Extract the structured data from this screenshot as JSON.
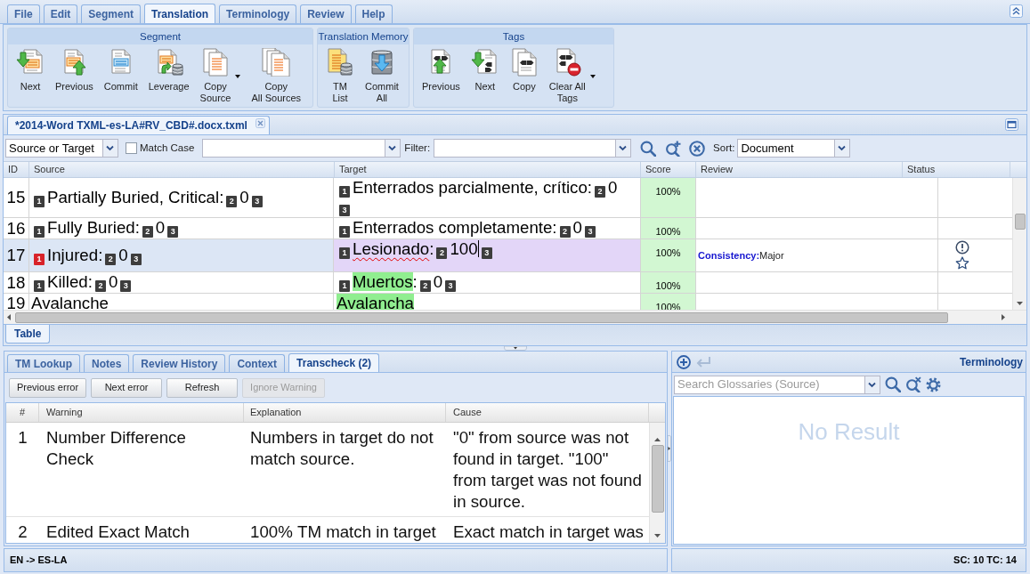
{
  "menu_tabs": [
    {
      "label": "File",
      "selected": false
    },
    {
      "label": "Edit",
      "selected": false
    },
    {
      "label": "Segment",
      "selected": false
    },
    {
      "label": "Translation",
      "selected": true
    },
    {
      "label": "Terminology",
      "selected": false
    },
    {
      "label": "Review",
      "selected": false
    },
    {
      "label": "Help",
      "selected": false
    }
  ],
  "ribbon_groups": [
    {
      "title": "Segment",
      "buttons": [
        {
          "label": "Next",
          "has_menu": false
        },
        {
          "label": "Previous",
          "has_menu": false
        },
        {
          "label": "Commit",
          "has_menu": false
        },
        {
          "label": "Leverage",
          "has_menu": false
        },
        {
          "label": "Copy\nSource",
          "has_menu": true
        },
        {
          "label": "Copy\nAll Sources",
          "has_menu": false
        }
      ]
    },
    {
      "title": "Translation Memory",
      "buttons": [
        {
          "label": "TM\nList",
          "has_menu": false
        },
        {
          "label": "Commit\nAll",
          "has_menu": false
        }
      ]
    },
    {
      "title": "Tags",
      "buttons": [
        {
          "label": "Previous",
          "has_menu": false
        },
        {
          "label": "Next",
          "has_menu": false
        },
        {
          "label": "Copy",
          "has_menu": false
        },
        {
          "label": "Clear All\nTags",
          "has_menu": true
        }
      ]
    }
  ],
  "document_tabs": [
    {
      "title": "*2014-Word TXML-es-LA#RV_CBD#.docx.txml",
      "selected": true
    }
  ],
  "filter_bar": {
    "scope": {
      "value": "Source or Target"
    },
    "match_case": {
      "label": "Match Case",
      "checked": false
    },
    "filter_label": "Filter:",
    "sort_label": "Sort:",
    "sort": {
      "value": "Document"
    }
  },
  "segment_table": {
    "columns": [
      "ID",
      "Source",
      "Target",
      "Score",
      "Review",
      "Status"
    ],
    "rows": [
      {
        "id": "15",
        "selected": false,
        "source": [
          {
            "kind": "tag",
            "label": "1",
            "active": false
          },
          {
            "kind": "text",
            "text": "Partially Buried, Critical:"
          },
          {
            "kind": "tag",
            "label": "2",
            "active": false
          },
          {
            "kind": "text",
            "text": "0"
          },
          {
            "kind": "tag",
            "label": "3",
            "active": false
          }
        ],
        "target": [
          {
            "kind": "tag",
            "label": "1",
            "active": false
          },
          {
            "kind": "text",
            "text": "Enterrados parcialmente, crítico:"
          },
          {
            "kind": "tag",
            "label": "2",
            "active": false
          },
          {
            "kind": "text",
            "text": "0"
          },
          {
            "kind": "tag",
            "label": "3",
            "active": false
          }
        ],
        "score": "100%",
        "warning": false,
        "starred": false
      },
      {
        "id": "16",
        "selected": false,
        "source": [
          {
            "kind": "tag",
            "label": "1",
            "active": false
          },
          {
            "kind": "text",
            "text": "Fully Buried:"
          },
          {
            "kind": "tag",
            "label": "2",
            "active": false
          },
          {
            "kind": "text",
            "text": "0"
          },
          {
            "kind": "tag",
            "label": "3",
            "active": false
          }
        ],
        "target": [
          {
            "kind": "tag",
            "label": "1",
            "active": false
          },
          {
            "kind": "text",
            "text": "Enterrados completamente:"
          },
          {
            "kind": "tag",
            "label": "2",
            "active": false
          },
          {
            "kind": "text",
            "text": "0"
          },
          {
            "kind": "tag",
            "label": "3",
            "active": false
          }
        ],
        "score": "100%",
        "warning": false,
        "starred": false
      },
      {
        "id": "17",
        "selected": true,
        "source": [
          {
            "kind": "tag",
            "label": "1",
            "active": true
          },
          {
            "kind": "text",
            "text": "Injured:"
          },
          {
            "kind": "tag",
            "label": "2",
            "active": false
          },
          {
            "kind": "text",
            "text": "0"
          },
          {
            "kind": "tag",
            "label": "3",
            "active": false
          }
        ],
        "target": [
          {
            "kind": "tag",
            "label": "1",
            "active": false
          },
          {
            "kind": "misspelled",
            "text": "Lesionado"
          },
          {
            "kind": "text",
            "text": ":"
          },
          {
            "kind": "tag",
            "label": "2",
            "active": false
          },
          {
            "kind": "text",
            "text": "100"
          },
          {
            "kind": "cursor"
          },
          {
            "kind": "tag",
            "label": "3",
            "active": false
          }
        ],
        "score": "100%",
        "review": {
          "category": "Consistency:",
          "severity": "Major"
        },
        "warning": true,
        "starred": true
      },
      {
        "id": "18",
        "selected": false,
        "source": [
          {
            "kind": "tag",
            "label": "1",
            "active": false
          },
          {
            "kind": "text",
            "text": "Killed:"
          },
          {
            "kind": "tag",
            "label": "2",
            "active": false
          },
          {
            "kind": "text",
            "text": "0"
          },
          {
            "kind": "tag",
            "label": "3",
            "active": false
          }
        ],
        "target": [
          {
            "kind": "tag",
            "label": "1",
            "active": false
          },
          {
            "kind": "match",
            "text": "Muertos"
          },
          {
            "kind": "text",
            "text": ":"
          },
          {
            "kind": "tag",
            "label": "2",
            "active": false
          },
          {
            "kind": "text",
            "text": "0"
          },
          {
            "kind": "tag",
            "label": "3",
            "active": false
          }
        ],
        "score": "100%",
        "warning": false,
        "starred": false
      },
      {
        "id": "19",
        "selected": false,
        "source": [
          {
            "kind": "text",
            "text": "Avalanche"
          }
        ],
        "target": [
          {
            "kind": "match",
            "text": "Avalancha"
          }
        ],
        "score": "100%",
        "warning": false,
        "starred": false
      }
    ]
  },
  "view_tabs": [
    {
      "label": "Table",
      "selected": true
    }
  ],
  "bottom_tabs": [
    {
      "label": "TM Lookup",
      "selected": false
    },
    {
      "label": "Notes",
      "selected": false
    },
    {
      "label": "Review History",
      "selected": false
    },
    {
      "label": "Context",
      "selected": false
    },
    {
      "label": "Transcheck (2)",
      "selected": true
    }
  ],
  "transcheck": {
    "buttons": [
      {
        "label": "Previous error",
        "disabled": false
      },
      {
        "label": "Next error",
        "disabled": false
      },
      {
        "label": "Refresh",
        "disabled": false
      },
      {
        "label": "Ignore Warning",
        "disabled": true
      }
    ],
    "columns": [
      "#",
      "Warning",
      "Explanation",
      "Cause"
    ],
    "rows": [
      {
        "number": "1",
        "warning": "Number Difference Check",
        "explanation": "Numbers in target do not match source.",
        "cause": "\"0\" from source was not found in target. \"100\" from target was not found in source."
      },
      {
        "number": "2",
        "warning": "Edited Exact Match",
        "explanation": "100% TM match in target",
        "cause": "Exact match in target was"
      }
    ]
  },
  "terminology": {
    "title": "Terminology",
    "actions": [
      {
        "disabled": false
      },
      {
        "disabled": true
      }
    ],
    "search": {
      "placeholder": "Search Glossaries (Source)"
    },
    "empty_message": "No Result"
  },
  "status_bar": {
    "language_pair": "EN -> ES-LA",
    "counts": "SC: 10 TC: 14"
  }
}
